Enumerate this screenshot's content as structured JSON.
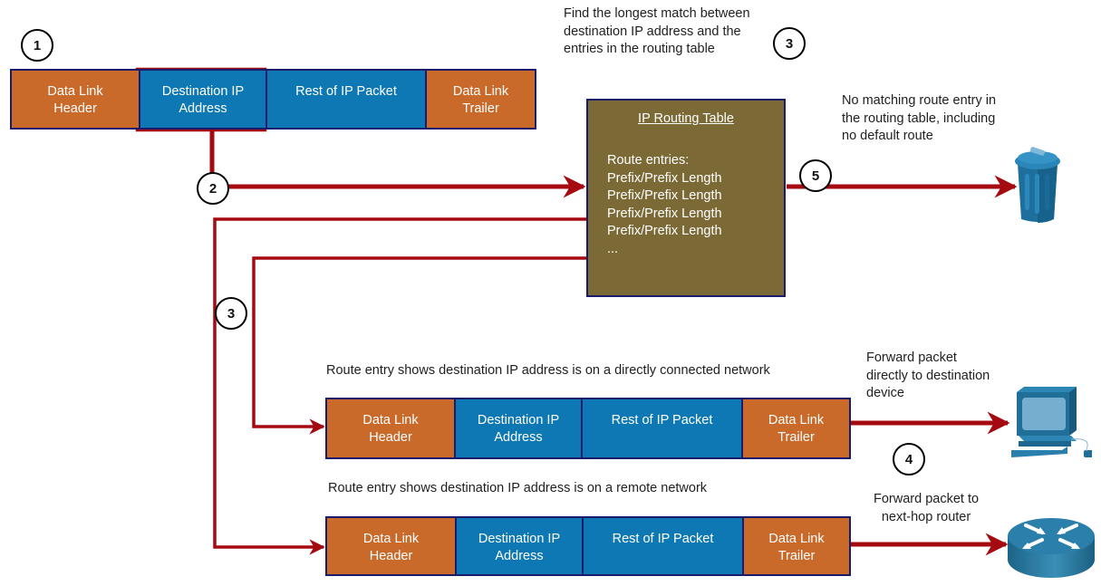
{
  "packet_fields": {
    "dl_header": [
      "Data Link",
      "Header"
    ],
    "dest_ip": [
      "Destination IP",
      "Address"
    ],
    "rest": [
      "Rest of IP Packet"
    ],
    "dl_trailer": [
      "Data Link",
      "Trailer"
    ]
  },
  "steps": {
    "s1": "1",
    "s2": "2",
    "s3_top": "3",
    "s3_left": "3",
    "s4": "4",
    "s5": "5"
  },
  "notes": {
    "longest_match": [
      "Find the longest match between",
      "destination IP address and the",
      "entries in the routing table"
    ],
    "no_match": [
      "No matching route entry in",
      "the routing table, including",
      "no default route"
    ],
    "direct_network": "Route entry shows destination IP address is on a directly connected network",
    "remote_network": "Route entry shows destination IP address is on a remote network",
    "forward_direct": [
      "Forward packet",
      "directly to destination",
      "device"
    ],
    "forward_nexthop": [
      "Forward packet to",
      "next-hop router"
    ]
  },
  "routing_table": {
    "title": "IP Routing Table",
    "header": "Route entries:",
    "entries": [
      "Prefix/Prefix Length",
      "Prefix/Prefix Length",
      "Prefix/Prefix Length",
      "Prefix/Prefix Length"
    ],
    "more": "..."
  },
  "icons": {
    "trash": "trash-can-icon",
    "pc": "pc-icon",
    "router": "router-icon"
  },
  "colors": {
    "header_trailer": "#c9692a",
    "ip": "#0e78b4",
    "border": "#1a1b6b",
    "arrow": "#a50a10",
    "routing_table": "#7b6a36"
  }
}
